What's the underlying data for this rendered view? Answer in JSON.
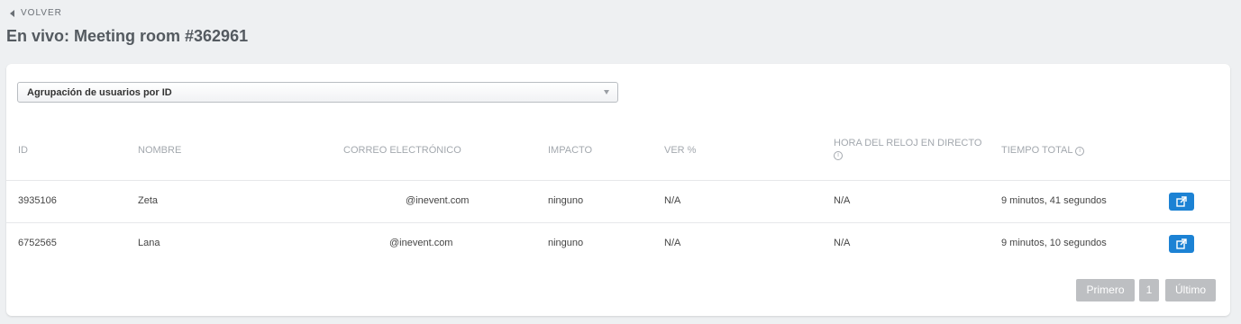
{
  "header": {
    "back_label": "VOLVER",
    "title": "En vivo: Meeting room #362961"
  },
  "filter": {
    "selected": "Agrupación de usuarios por ID"
  },
  "table": {
    "columns": [
      "ID",
      "NOMBRE",
      "CORREO ELECTRÓNICO",
      "IMPACTO",
      "VER %",
      "HORA DEL RELOJ EN DIRECTO",
      "TIEMPO TOTAL"
    ],
    "rows": [
      {
        "id": "3935106",
        "name": "Zeta",
        "email": "@inevent.com",
        "impact": "ninguno",
        "view": "N/A",
        "live_clock": "N/A",
        "total_time": "9 minutos, 41 segundos"
      },
      {
        "id": "6752565",
        "name": "Lana",
        "email": "@inevent.com",
        "impact": "ninguno",
        "view": "N/A",
        "live_clock": "N/A",
        "total_time": "9 minutos, 10 segundos"
      }
    ]
  },
  "pagination": {
    "first_label": "Primero",
    "current_page": "1",
    "last_label": "Último"
  },
  "icons": {
    "back": "caret-left-icon",
    "info": "info-circle-icon",
    "open": "external-link-icon",
    "select": "caret-down-icon"
  },
  "colors": {
    "accent": "#1c82d4",
    "pager_bg": "#bdbfc2",
    "page_bg": "#eef0f2"
  }
}
